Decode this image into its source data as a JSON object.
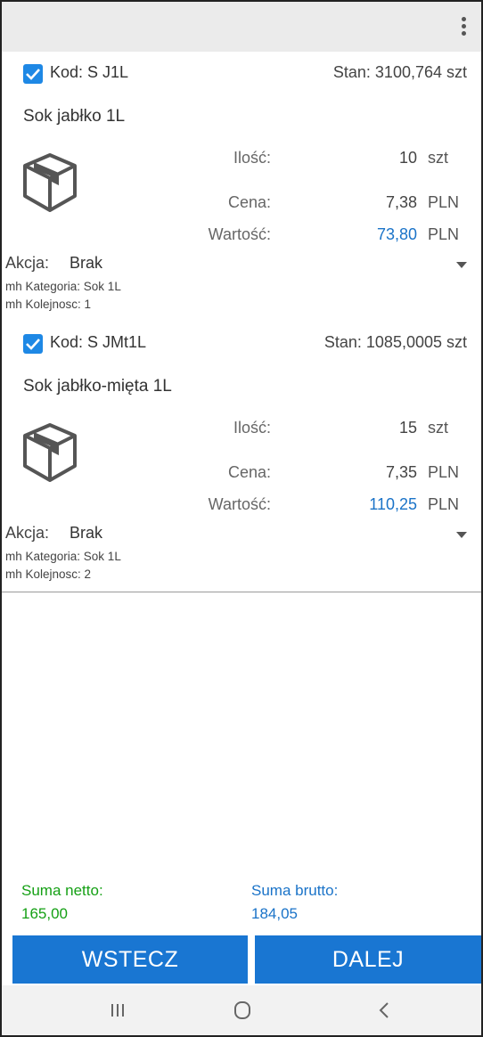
{
  "items": [
    {
      "code": "Kod: S J1L",
      "stock": "Stan: 3100,764 szt",
      "name": "Sok jabłko 1L",
      "qty_label": "Ilość:",
      "qty": "10",
      "qty_unit": "szt",
      "price_label": "Cena:",
      "price": "7,38",
      "price_unit": "PLN",
      "value_label": "Wartość:",
      "value": "73,80",
      "value_unit": "PLN",
      "action_label": "Akcja:",
      "action": "Brak",
      "category": "mh Kategoria: Sok 1L",
      "order": "mh Kolejnosc: 1"
    },
    {
      "code": "Kod: S JMt1L",
      "stock": "Stan: 1085,0005 szt",
      "name": "Sok jabłko-mięta 1L",
      "qty_label": "Ilość:",
      "qty": "15",
      "qty_unit": "szt",
      "price_label": "Cena:",
      "price": "7,35",
      "price_unit": "PLN",
      "value_label": "Wartość:",
      "value": "110,25",
      "value_unit": "PLN",
      "action_label": "Akcja:",
      "action": "Brak",
      "category": "mh Kategoria: Sok 1L",
      "order": "mh Kolejnosc: 2"
    }
  ],
  "summary": {
    "net_label": "Suma netto:",
    "net_value": "165,00",
    "gross_label": "Suma brutto:",
    "gross_value": "184,05"
  },
  "buttons": {
    "back": "WSTECZ",
    "next": "DALEJ"
  },
  "colors": {
    "accent": "#1976d2",
    "checkbox": "#1e88e5",
    "net_green": "#15a015",
    "value_blue": "#1a73c8"
  },
  "icons": {
    "menu": "more-vert-icon",
    "product": "package-box-icon",
    "nav_recent": "recent-apps-icon",
    "nav_home": "home-icon",
    "nav_back": "back-icon"
  }
}
